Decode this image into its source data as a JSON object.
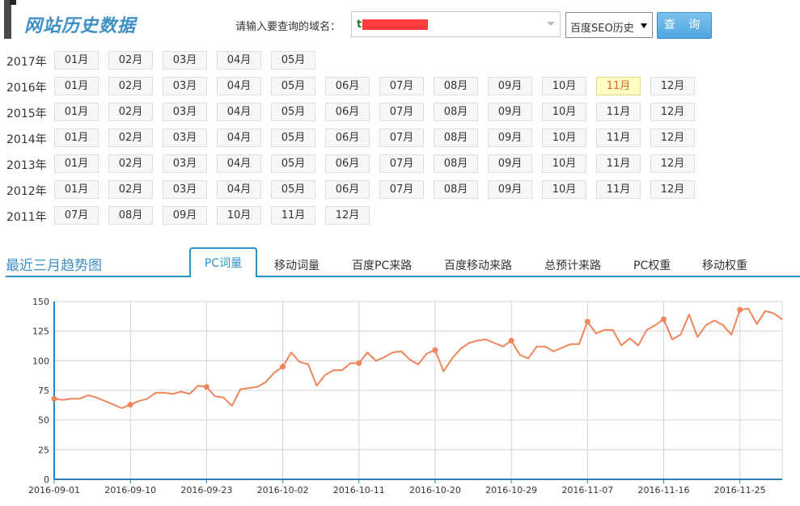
{
  "header": {
    "title": "网站历史数据",
    "domain_label": "请输入要查询的域名：",
    "domain_value": "t",
    "type_selected": "百度SEO历史",
    "query_label": "查 询"
  },
  "history": [
    {
      "year": "2017年",
      "months": [
        "01月",
        "02月",
        "03月",
        "04月",
        "05月"
      ]
    },
    {
      "year": "2016年",
      "months": [
        "01月",
        "02月",
        "03月",
        "04月",
        "05月",
        "06月",
        "07月",
        "08月",
        "09月",
        "10月",
        "11月",
        "12月"
      ],
      "active": "11月"
    },
    {
      "year": "2015年",
      "months": [
        "01月",
        "02月",
        "03月",
        "04月",
        "05月",
        "06月",
        "07月",
        "08月",
        "09月",
        "10月",
        "11月",
        "12月"
      ]
    },
    {
      "year": "2014年",
      "months": [
        "01月",
        "02月",
        "03月",
        "04月",
        "05月",
        "06月",
        "07月",
        "08月",
        "09月",
        "10月",
        "11月",
        "12月"
      ]
    },
    {
      "year": "2013年",
      "months": [
        "01月",
        "02月",
        "03月",
        "04月",
        "05月",
        "06月",
        "07月",
        "08月",
        "09月",
        "10月",
        "11月",
        "12月"
      ]
    },
    {
      "year": "2012年",
      "months": [
        "01月",
        "02月",
        "03月",
        "04月",
        "05月",
        "06月",
        "07月",
        "08月",
        "09月",
        "10月",
        "11月",
        "12月"
      ]
    },
    {
      "year": "2011年",
      "months": [
        "07月",
        "08月",
        "09月",
        "10月",
        "11月",
        "12月"
      ]
    }
  ],
  "trend": {
    "title": "最近三月趋势图",
    "tabs": [
      "PC词量",
      "移动词量",
      "百度PC来路",
      "百度移动来路",
      "总预计来路",
      "PC权重",
      "移动权重"
    ],
    "active_tab": "PC词量"
  },
  "chart_data": {
    "type": "line",
    "series_color": "#f0845a",
    "ylim": [
      0,
      150
    ],
    "yticks": [
      0,
      25,
      50,
      75,
      100,
      125,
      150
    ],
    "xtick_labels": [
      "2016-09-01",
      "2016-09-10",
      "2016-09-23",
      "2016-10-02",
      "2016-10-11",
      "2016-10-20",
      "2016-10-29",
      "2016-11-07",
      "2016-11-16",
      "2016-11-25"
    ],
    "grid": true,
    "markers_every": 9,
    "values": [
      68,
      67,
      68,
      68,
      71,
      69,
      66,
      63,
      60,
      63,
      66,
      68,
      73,
      73,
      72,
      74,
      72,
      79,
      78,
      70,
      69,
      62,
      76,
      77,
      78,
      82,
      90,
      95,
      107,
      99,
      97,
      79,
      88,
      92,
      92,
      98,
      98,
      107,
      100,
      103,
      107,
      108,
      101,
      97,
      106,
      109,
      91,
      102,
      110,
      115,
      117,
      118,
      115,
      112,
      117,
      105,
      102,
      112,
      112,
      108,
      111,
      114,
      114,
      133,
      123,
      126,
      126,
      113,
      119,
      113,
      126,
      130,
      135,
      118,
      122,
      139,
      120,
      130,
      134,
      130,
      122,
      143,
      144,
      131,
      142,
      140,
      135
    ]
  }
}
